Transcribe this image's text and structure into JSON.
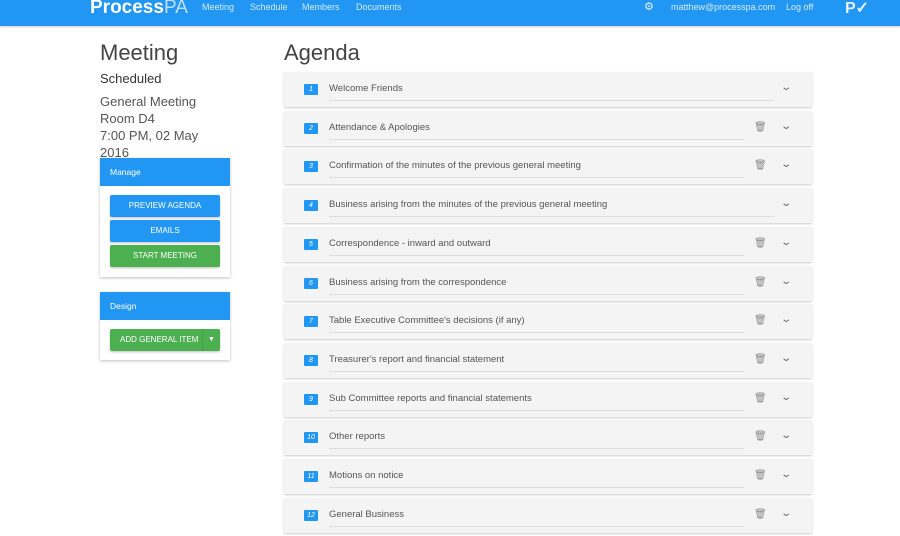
{
  "header": {
    "logo_bold": "Process",
    "logo_light": "PA",
    "nav": [
      "Meeting",
      "Schedule",
      "Members",
      "Documents"
    ],
    "settings_icon": "gear-icon",
    "user_email": "matthew@processpa.com",
    "logout": "Log off",
    "brand_icon": "processpa-logo-icon"
  },
  "meeting": {
    "title": "Meeting",
    "status": "Scheduled",
    "type": "General Meeting",
    "room": "Room D4",
    "datetime": "7:00 PM, 02 May 2016"
  },
  "manage": {
    "title": "Manage",
    "preview": "PREVIEW AGENDA",
    "emails": "EMAILS",
    "start": "START MEETING"
  },
  "design": {
    "title": "Design",
    "add": "ADD GENERAL ITEM",
    "dropdown_icon": "caret-down-icon"
  },
  "agenda": {
    "title": "Agenda",
    "items": [
      {
        "num": "1",
        "label": "Welcome Friends",
        "deletable": false
      },
      {
        "num": "2",
        "label": "Attendance & Apologies",
        "deletable": true
      },
      {
        "num": "3",
        "label": "Confirmation of the minutes of the previous general meeting",
        "deletable": true
      },
      {
        "num": "4",
        "label": "Business arising from the minutes of the previous general meeting",
        "deletable": false
      },
      {
        "num": "5",
        "label": "Correspondence - inward and outward",
        "deletable": true
      },
      {
        "num": "6",
        "label": "Business arising from the correspondence",
        "deletable": true
      },
      {
        "num": "7",
        "label": "Table Executive Committee's decisions (if any)",
        "deletable": true
      },
      {
        "num": "8",
        "label": "Treasurer's report and financial statement",
        "deletable": true
      },
      {
        "num": "9",
        "label": "Sub Committee reports and financial statements",
        "deletable": true
      },
      {
        "num": "10",
        "label": "Other reports",
        "deletable": true
      },
      {
        "num": "11",
        "label": "Motions on notice",
        "deletable": true
      },
      {
        "num": "12",
        "label": "General Business",
        "deletable": true
      }
    ]
  },
  "colors": {
    "primary": "#2196f3",
    "success": "#4caf50"
  }
}
